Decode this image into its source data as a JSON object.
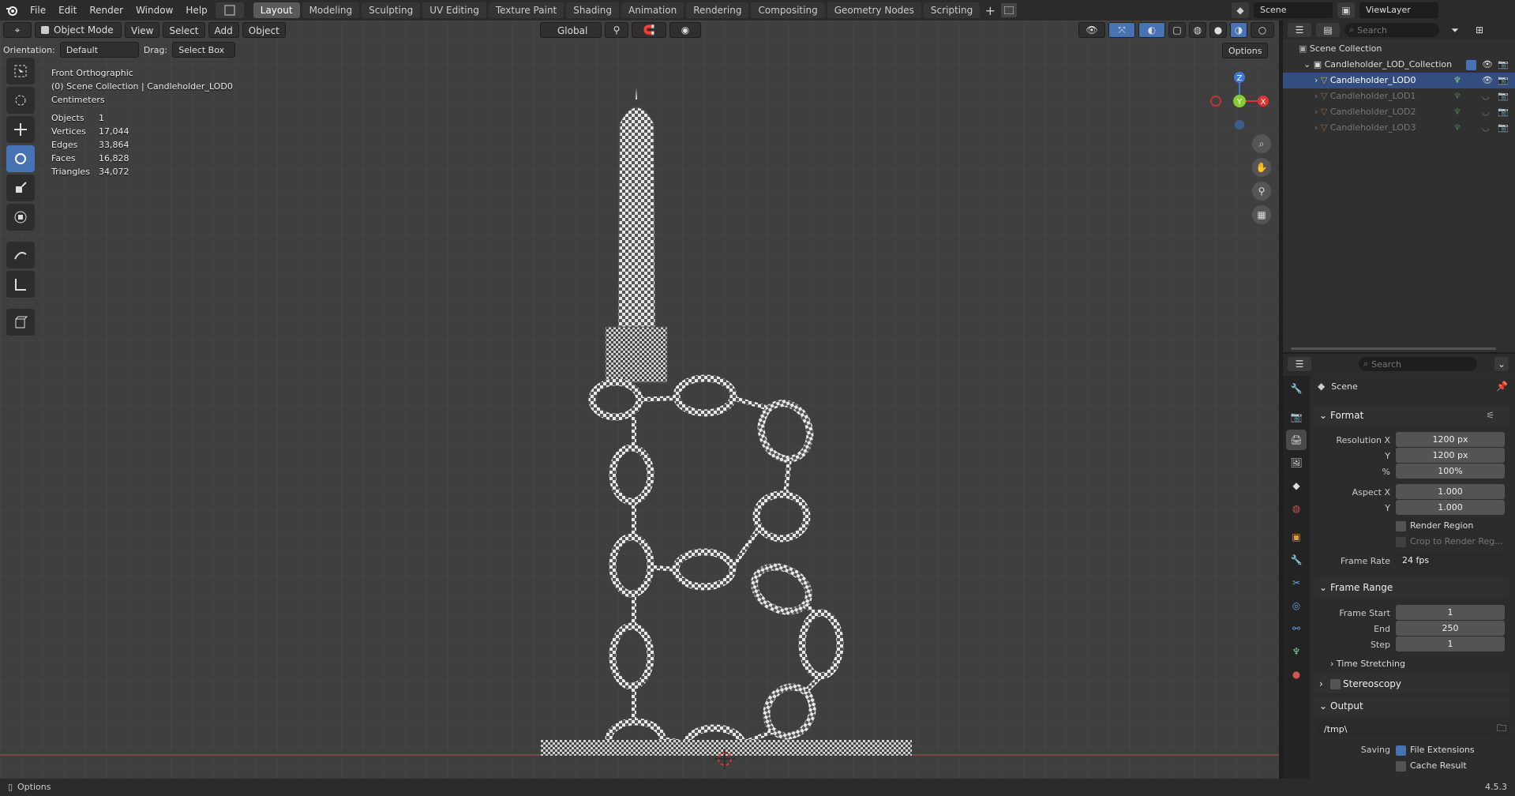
{
  "menu": [
    "File",
    "Edit",
    "Render",
    "Window",
    "Help"
  ],
  "workspaces": [
    "Layout",
    "Modeling",
    "Sculpting",
    "UV Editing",
    "Texture Paint",
    "Shading",
    "Animation",
    "Rendering",
    "Compositing",
    "Geometry Nodes",
    "Scripting"
  ],
  "active_workspace": "Layout",
  "scene_field": "Scene",
  "viewlayer_field": "ViewLayer",
  "viewport_header": {
    "mode": "Object Mode",
    "view": "View",
    "select": "Select",
    "add": "Add",
    "object": "Object",
    "transform": "Global",
    "orientation_label": "Orientation:",
    "orientation_value": "Default",
    "drag_label": "Drag:",
    "drag_value": "Select Box",
    "options": "Options"
  },
  "overlay_info": {
    "view_name": "Front Orthographic",
    "collection": "(0) Scene Collection | Candleholder_LOD0",
    "units": "Centimeters",
    "stats": [
      {
        "label": "Objects",
        "value": "1"
      },
      {
        "label": "Vertices",
        "value": "17,044"
      },
      {
        "label": "Edges",
        "value": "33,864"
      },
      {
        "label": "Faces",
        "value": "16,828"
      },
      {
        "label": "Triangles",
        "value": "34,072"
      }
    ]
  },
  "gizmo": {
    "x": "X",
    "y": "Y",
    "z": "Z"
  },
  "outliner": {
    "search_placeholder": "Search",
    "root": "Scene Collection",
    "collection": "Candleholder_LOD_Collection",
    "items": [
      "Candleholder_LOD0",
      "Candleholder_LOD1",
      "Candleholder_LOD2",
      "Candleholder_LOD3"
    ]
  },
  "properties": {
    "search_placeholder": "Search",
    "context": "Scene",
    "format": {
      "title": "Format",
      "res_x_label": "Resolution X",
      "res_x": "1200 px",
      "res_y_label": "Y",
      "res_y": "1200 px",
      "pct_label": "%",
      "pct": "100%",
      "aspect_x_label": "Aspect X",
      "aspect_x": "1.000",
      "aspect_y_label": "Y",
      "aspect_y": "1.000",
      "render_region": "Render Region",
      "crop": "Crop to Render Reg...",
      "frame_rate_label": "Frame Rate",
      "frame_rate": "24 fps"
    },
    "frame_range": {
      "title": "Frame Range",
      "start_label": "Frame Start",
      "start": "1",
      "end_label": "End",
      "end": "250",
      "step_label": "Step",
      "step": "1",
      "time_stretching": "Time Stretching"
    },
    "stereoscopy": "Stereoscopy",
    "output": {
      "title": "Output",
      "path": "/tmp\\",
      "saving_label": "Saving",
      "file_ext": "File Extensions",
      "cache": "Cache Result"
    }
  },
  "status": {
    "left": "Options",
    "version": "4.5.3"
  }
}
